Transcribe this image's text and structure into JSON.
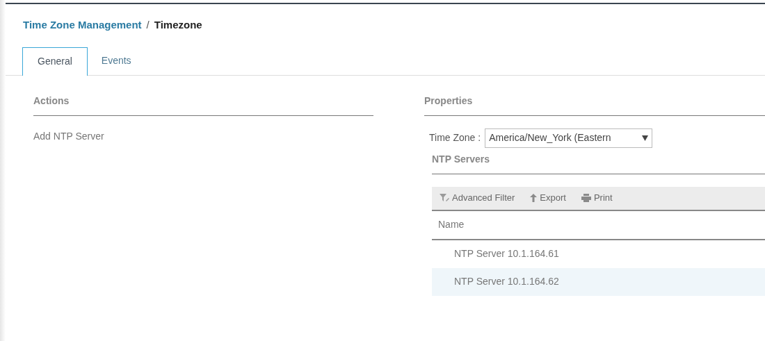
{
  "breadcrumb": {
    "parent": "Time Zone Management",
    "separator": "/",
    "current": "Timezone"
  },
  "tabs": [
    {
      "label": "General",
      "selected": true
    },
    {
      "label": "Events",
      "selected": false
    }
  ],
  "actions": {
    "title": "Actions",
    "items": [
      "Add NTP Server"
    ]
  },
  "properties": {
    "title": "Properties",
    "time_zone": {
      "label": "Time Zone :",
      "value": "America/New_York (Eastern"
    },
    "ntp_servers": {
      "title": "NTP Servers",
      "toolbar": [
        {
          "kind": "filter",
          "label": "Advanced Filter"
        },
        {
          "kind": "export",
          "label": "Export"
        },
        {
          "kind": "print",
          "label": "Print"
        }
      ],
      "columns": [
        "Name"
      ],
      "rows": [
        {
          "name": "NTP Server 10.1.164.61",
          "selected": false
        },
        {
          "name": "NTP Server 10.1.164.62",
          "selected": true
        }
      ]
    }
  }
}
